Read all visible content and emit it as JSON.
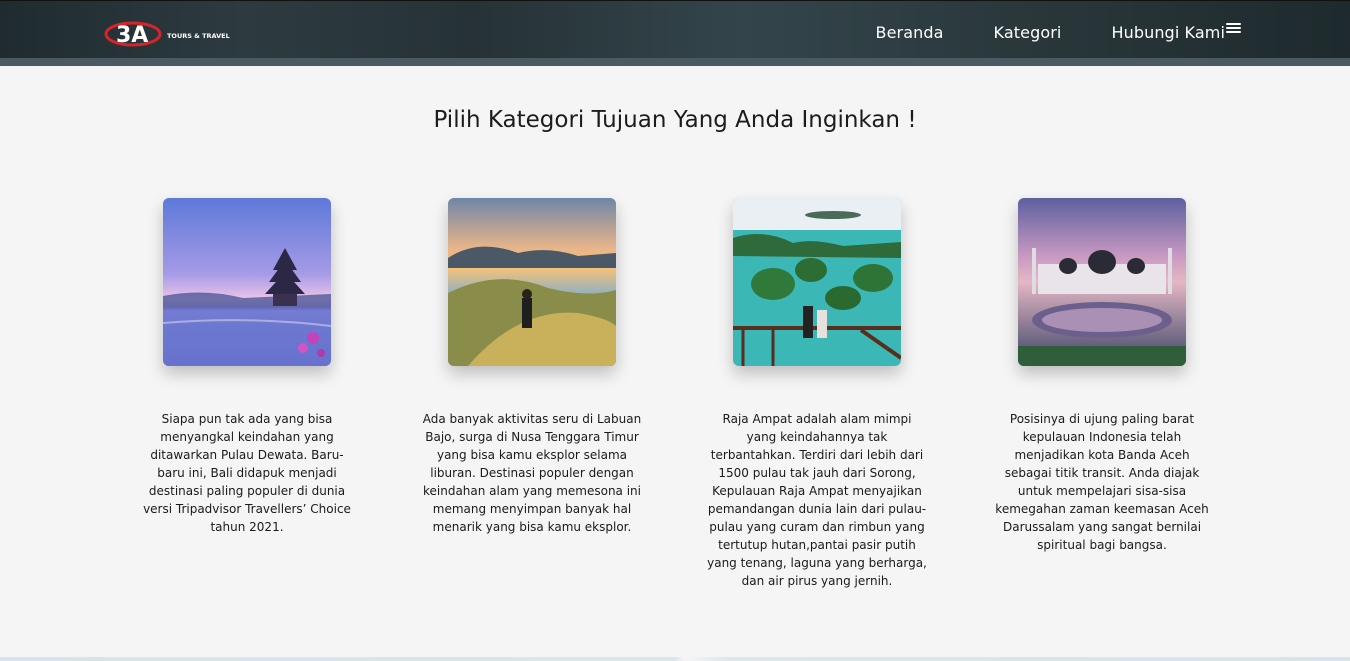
{
  "brand": {
    "logo_text": "3A",
    "logo_subtext": "TOURS & TRAVEL"
  },
  "nav": {
    "items": [
      {
        "label": "Beranda"
      },
      {
        "label": "Kategori"
      },
      {
        "label": "Hubungi Kami"
      }
    ],
    "menu_icon": "hamburger-menu-icon"
  },
  "page": {
    "title": "Pilih Kategori Tujuan Yang Anda Inginkan !"
  },
  "categories": [
    {
      "image_name": "bali-temple-image",
      "description": "Siapa pun tak ada yang bisa menyangkal keindahan yang ditawarkan Pulau Dewata. Baru-baru ini, Bali didapuk menjadi destinasi paling populer di dunia versi Tripadvisor Travellers’ Choice tahun 2021."
    },
    {
      "image_name": "labuan-bajo-image",
      "description": "Ada banyak aktivitas seru di Labuan Bajo, surga di Nusa Tenggara Timur yang bisa kamu eksplor selama liburan. Destinasi populer dengan keindahan alam yang memesona ini memang menyimpan banyak hal menarik yang bisa kamu eksplor."
    },
    {
      "image_name": "raja-ampat-image",
      "description": "Raja Ampat adalah alam mimpi yang keindahannya tak terbantahkan. Terdiri dari lebih dari 1500 pulau tak jauh dari Sorong, Kepulauan Raja Ampat menyajikan pemandangan dunia lain dari pulau-pulau yang curam dan rimbun yang tertutup hutan,pantai pasir putih yang tenang, laguna yang berharga, dan air pirus yang jernih."
    },
    {
      "image_name": "banda-aceh-mosque-image",
      "description": "Posisinya di ujung paling barat kepulauan Indonesia telah menjadikan kota Banda Aceh sebagai titik transit. Anda diajak untuk mempelajari sisa-sisa kemegahan zaman keemasan Aceh Darussalam yang sangat bernilai spiritual bagi bangsa."
    }
  ]
}
